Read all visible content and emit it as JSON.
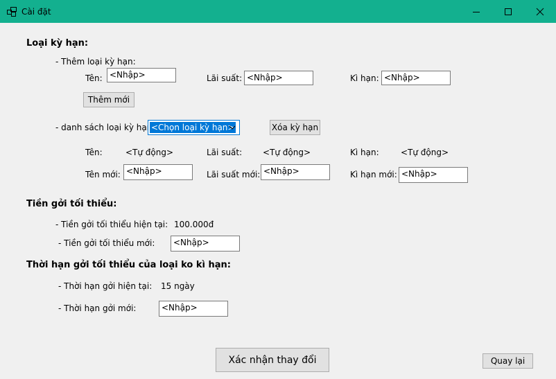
{
  "window": {
    "title": "Cài đặt"
  },
  "term_type": {
    "heading": "Loại kỳ hạn:",
    "add_label": "- Thêm loại kỳ hạn:",
    "name_label": "Tên:",
    "name_value": "<Nhập>",
    "rate_label": "Lãi suất:",
    "rate_value": "<Nhập>",
    "term_label": "Kì hạn:",
    "term_value": "<Nhập>",
    "add_button": "Thêm mới",
    "list_label": "- danh sách loại kỳ hạn:",
    "select_value": "<Chọn loại kỳ hạn>",
    "delete_button": "Xóa kỳ hạn",
    "cur_name_label": "Tên:",
    "cur_name_value": "<Tự động>",
    "cur_rate_label": "Lãi suất:",
    "cur_rate_value": "<Tự động>",
    "cur_term_label": "Kì hạn:",
    "cur_term_value": "<Tự động>",
    "new_name_label": "Tên mới:",
    "new_name_value": "<Nhập>",
    "new_rate_label": "Lãi suất mới:",
    "new_rate_value": "<Nhập>",
    "new_term_label": "Kì hạn mới:",
    "new_term_value": "<Nhập>"
  },
  "min_deposit": {
    "heading": "Tiền gởi tối thiểu:",
    "current_label": "- Tiền gởi tối thiểu hiện tại:",
    "current_value": "100.000đ",
    "new_label": "- Tiền gởi tối thiểu mới:",
    "new_value": "<Nhập>"
  },
  "min_duration": {
    "heading": "Thời hạn gởi tối thiểu của loại ko kì hạn:",
    "current_label": "- Thời hạn gởi hiện tại:",
    "current_value": "15 ngày",
    "new_label": "- Thời hạn gởi mới:",
    "new_value": "<Nhập>"
  },
  "actions": {
    "confirm": "Xác nhận thay đổi",
    "back": "Quay lại"
  }
}
